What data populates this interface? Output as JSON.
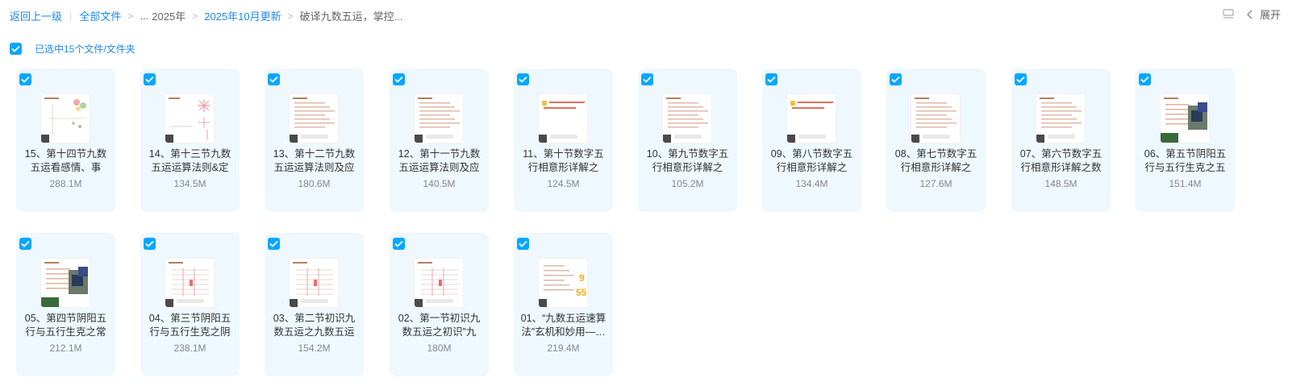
{
  "breadcrumb": {
    "back": "返回上一级",
    "all_files": "全部文件",
    "ellipsis": "...",
    "year": "2025年",
    "month": "2025年10月更新",
    "current": "破译九数五运，掌控..."
  },
  "toolbar": {
    "expand_label": "展开"
  },
  "selection": {
    "label": "已选中15个文件/文件夹"
  },
  "colors": {
    "accent": "#06a7ff",
    "link": "#1e88e5",
    "card_bg": "#eef8fe"
  },
  "files": [
    {
      "name": "15、第十四节九数五运看感情、事",
      "size": "288.1M",
      "thumb": "chart-diagram",
      "checked": true
    },
    {
      "name": "14、第十三节九数五运运算法则&定",
      "size": "134.5M",
      "thumb": "star-diagram",
      "checked": true
    },
    {
      "name": "13、第十二节九数五运运算法则及应",
      "size": "180.6M",
      "thumb": "text-slide",
      "checked": true
    },
    {
      "name": "12、第十一节九数五运运算法则及应",
      "size": "140.5M",
      "thumb": "text-slide",
      "checked": true
    },
    {
      "name": "11、第十节数字五行相意形详解之",
      "size": "124.5M",
      "thumb": "question-slide",
      "checked": true
    },
    {
      "name": "10、第九节数字五行相意形详解之",
      "size": "105.2M",
      "thumb": "text-slide",
      "checked": true
    },
    {
      "name": "09、第八节数字五行相意形详解之",
      "size": "134.4M",
      "thumb": "question-slide",
      "checked": true
    },
    {
      "name": "08、第七节数字五行相意形详解之",
      "size": "127.6M",
      "thumb": "text-slide",
      "checked": true
    },
    {
      "name": "07、第六节数字五行相意形详解之数",
      "size": "148.5M",
      "thumb": "text-slide",
      "checked": true
    },
    {
      "name": "06、第五节阴阳五行与五行生克之五",
      "size": "151.4M",
      "thumb": "photo-slide",
      "checked": true
    },
    {
      "name": "05、第四节阴阳五行与五行生克之常",
      "size": "212.1M",
      "thumb": "photo-slide",
      "checked": true
    },
    {
      "name": "04、第三节阴阳五行与五行生克之阴",
      "size": "238.1M",
      "thumb": "table-slide",
      "checked": true
    },
    {
      "name": "03、第二节初识九数五运之九数五运",
      "size": "154.2M",
      "thumb": "table-slide",
      "checked": true
    },
    {
      "name": "02、第一节初识九数五运之初识”九",
      "size": "180M",
      "thumb": "table-slide",
      "checked": true
    },
    {
      "name": "01、“九数五运速算法”玄机和妙用—…",
      "size": "219.4M",
      "thumb": "number-slide",
      "checked": true
    }
  ],
  "thumb_numbers": {
    "n1": "9",
    "n2": "55"
  }
}
